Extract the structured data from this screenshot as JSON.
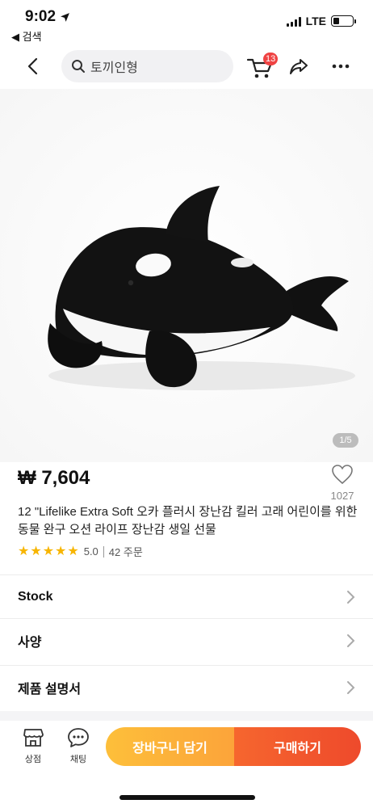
{
  "status_bar": {
    "time": "9:02",
    "back_label": "◀ 검색",
    "network": "LTE",
    "battery_level": 0.3
  },
  "nav": {
    "search_text": "토끼인형",
    "cart_count": "13",
    "icons": [
      "chevron-left-icon",
      "search-icon",
      "cart-icon",
      "share-icon",
      "more-icon"
    ]
  },
  "gallery": {
    "page_indicator": "1/5"
  },
  "product": {
    "price": "₩ 7,604",
    "likes": "1027",
    "title": "12 \"Lifelike Extra Soft 오카 플러시 장난감 킬러 고래 어린이를 위한 동물 완구 오션 라이프 장난감 생일 선물",
    "rating_score": "5.0",
    "stars": 5,
    "orders": "42 주문",
    "star_color": "#f7b500"
  },
  "sections": [
    {
      "label": "Stock"
    },
    {
      "label": "사양"
    },
    {
      "label": "제품 설명서"
    }
  ],
  "bottom_bar": {
    "store_label": "상점",
    "chat_label": "채팅",
    "add_to_cart_label": "장바구니 담기",
    "buy_label": "구매하기",
    "cart_color": "#fcae3a",
    "buy_color": "#f2552d"
  }
}
